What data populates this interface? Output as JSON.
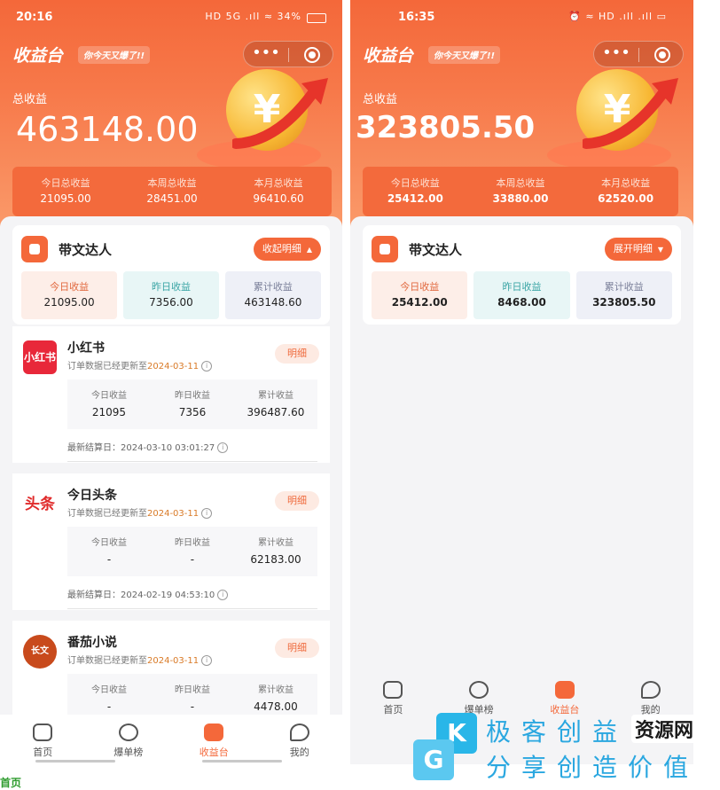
{
  "left": {
    "status": {
      "time": "20:16",
      "icons": "HD 5G .ıll ≈ 34%"
    },
    "brand": "收益台",
    "slogan": "你今天又爆了!!",
    "total_label": "总收益",
    "total_value": "463148.00",
    "summary": [
      {
        "label": "今日总收益",
        "value": "21095.00"
      },
      {
        "label": "本周总收益",
        "value": "28451.00"
      },
      {
        "label": "本月总收益",
        "value": "96410.60"
      }
    ],
    "card": {
      "title": "带文达人",
      "toggle": "收起明细",
      "stats": [
        {
          "label": "今日收益",
          "value": "21095.00"
        },
        {
          "label": "昨日收益",
          "value": "7356.00"
        },
        {
          "label": "累计收益",
          "value": "463148.60"
        }
      ]
    },
    "platforms": [
      {
        "name": "小红书",
        "logo_text": "小红书",
        "logo_color": "#e8283a",
        "sub_prefix": "订单数据已经更新至",
        "date": "2024-03-11",
        "detail": "明细",
        "cols": [
          {
            "label": "今日收益",
            "value": "21095"
          },
          {
            "label": "昨日收益",
            "value": "7356"
          },
          {
            "label": "累计收益",
            "value": "396487.60"
          }
        ],
        "settle": "最新结算日：2024-03-10 03:01:27"
      },
      {
        "name": "今日头条",
        "logo_text": "头条",
        "logo_color": "#e02a2a",
        "sub_prefix": "订单数据已经更新至",
        "date": "2024-03-11",
        "detail": "明细",
        "cols": [
          {
            "label": "今日收益",
            "value": "-"
          },
          {
            "label": "昨日收益",
            "value": "-"
          },
          {
            "label": "累计收益",
            "value": "62183.00"
          }
        ],
        "settle": "最新结算日：2024-02-19 04:53:10"
      },
      {
        "name": "番茄小说",
        "logo_text": "长文",
        "logo_color": "#c84a1c",
        "sub_prefix": "订单数据已经更新至",
        "date": "2024-03-11",
        "detail": "明细",
        "cols": [
          {
            "label": "今日收益",
            "value": "-"
          },
          {
            "label": "昨日收益",
            "value": "-"
          },
          {
            "label": "累计收益",
            "value": "4478.00"
          }
        ]
      }
    ],
    "tabs": [
      "首页",
      "爆单榜",
      "收益台",
      "我的"
    ]
  },
  "right": {
    "status": {
      "time": "16:35",
      "icons": "⏰ ≈ HD .ıll .ıll ▭"
    },
    "brand": "收益台",
    "slogan": "你今天又爆了!!",
    "total_label": "总收益",
    "total_value": "323805.50",
    "summary": [
      {
        "label": "今日总收益",
        "value": "25412.00"
      },
      {
        "label": "本周总收益",
        "value": "33880.00"
      },
      {
        "label": "本月总收益",
        "value": "62520.00"
      }
    ],
    "card": {
      "title": "带文达人",
      "toggle": "展开明细",
      "stats": [
        {
          "label": "今日收益",
          "value": "25412.00"
        },
        {
          "label": "昨日收益",
          "value": "8468.00"
        },
        {
          "label": "累计收益",
          "value": "323805.50"
        }
      ]
    },
    "tabs": [
      "首页",
      "爆单榜",
      "收益台",
      "我的"
    ]
  },
  "watermark": {
    "k": "K",
    "g": "G",
    "line1": "极客创益",
    "line2": "分享创造价值",
    "badge": "资源网"
  },
  "corner_text": "首页",
  "info_glyph": "i",
  "colors": {
    "brand": "#f4683a",
    "date": "#d97a27"
  }
}
